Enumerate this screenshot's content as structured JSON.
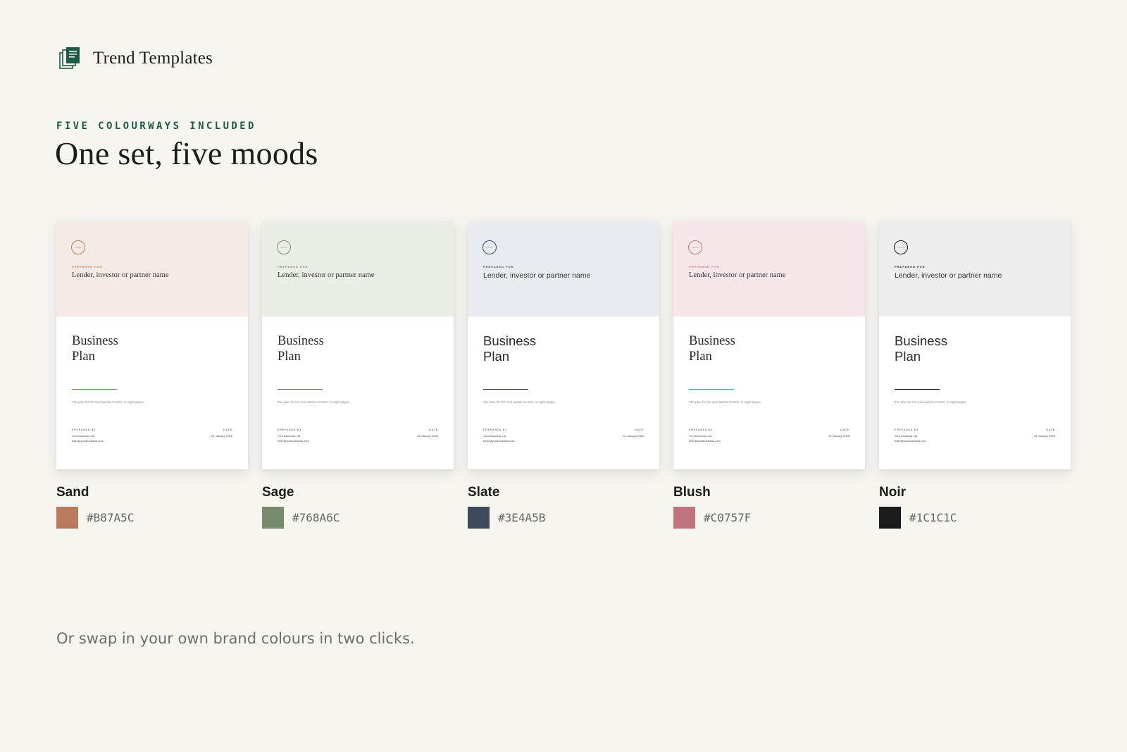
{
  "brand": {
    "name": "Trend Templates",
    "icon": "stacked-document-icon",
    "icon_color": "#1f5a46"
  },
  "hero": {
    "eyebrow": "FIVE COLOURWAYS INCLUDED",
    "headline": "One set, five moods"
  },
  "cover": {
    "logo": "LOGO",
    "prepared_for_label": "PREPARED FOR",
    "recipient": "Lender, investor or partner name",
    "title_line1": "Business",
    "title_line2": "Plan",
    "tagline": "The plan for the next twelve months, in eight pages.",
    "prepared_by_label": "PREPARED BY",
    "business": "Your Business Ltd",
    "email": "hello@yourbusiness.com",
    "date_label": "DATE",
    "date": "01 January 2026"
  },
  "colourways": [
    {
      "name": "Sand",
      "hex": "#B87A5C",
      "tint": "#f6ebe4",
      "font": "serif"
    },
    {
      "name": "Sage",
      "hex": "#768A6C",
      "tint": "#ebeee5",
      "font": "serif"
    },
    {
      "name": "Slate",
      "hex": "#3E4A5B",
      "tint": "#e8ecf0",
      "font": "sans"
    },
    {
      "name": "Blush",
      "hex": "#C0757F",
      "tint": "#f8e7ea",
      "font": "serif"
    },
    {
      "name": "Noir",
      "hex": "#1C1C1C",
      "tint": "#eeeded",
      "font": "sans"
    }
  ],
  "footer_note": "Or swap in your own brand colours in two clicks."
}
